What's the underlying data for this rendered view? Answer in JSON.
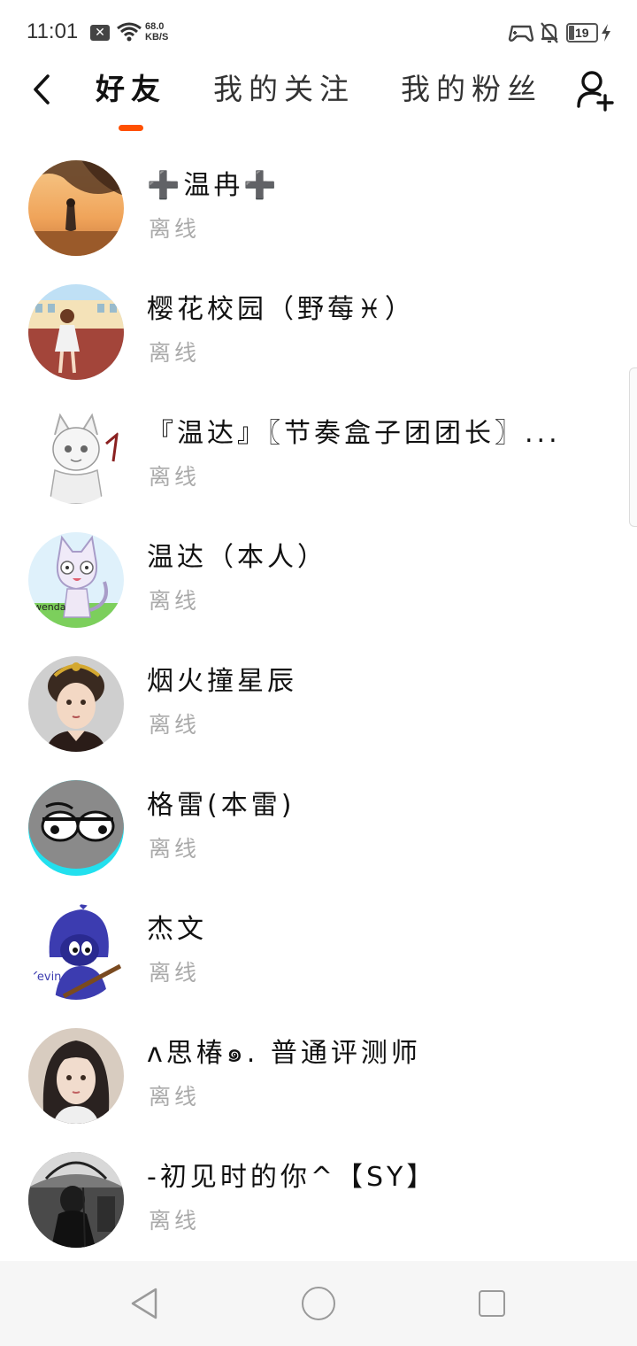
{
  "status_bar": {
    "time": "11:01",
    "network_speed_value": "68.0",
    "network_speed_unit": "KB/S",
    "battery_level": "19"
  },
  "header": {
    "tabs": [
      {
        "label": "好友",
        "active": true
      },
      {
        "label": "我的关注",
        "active": false
      },
      {
        "label": "我的粉丝",
        "active": false
      }
    ],
    "accent_color": "#ff5000"
  },
  "friends": [
    {
      "name": "➕温冉➕",
      "status": "离线"
    },
    {
      "name": "樱花校园（野莓♓）",
      "status": "离线"
    },
    {
      "name": "『温达』〖节奏盒子团团长〗...",
      "status": "离线"
    },
    {
      "name": "温达（本人）",
      "status": "离线"
    },
    {
      "name": "烟火撞星辰",
      "status": "离线"
    },
    {
      "name": "格雷(本雷)",
      "status": "离线"
    },
    {
      "name": "杰文",
      "status": "离线"
    },
    {
      "name": "ʌ思椿๑. 普通评测师",
      "status": "离线"
    },
    {
      "name": "-初见时的你^【SY】",
      "status": "离线"
    }
  ],
  "avatar_labels": {
    "wenda": "wenda",
    "kevin": "Kevin"
  },
  "icons": {
    "back": "chevron-left-icon",
    "add_friend": "add-user-icon",
    "status_x": "close-box-icon",
    "wifi": "wifi-icon",
    "gamepad": "gamepad-icon",
    "bell": "bell-muted-icon",
    "battery": "battery-icon",
    "charging": "bolt-icon"
  }
}
